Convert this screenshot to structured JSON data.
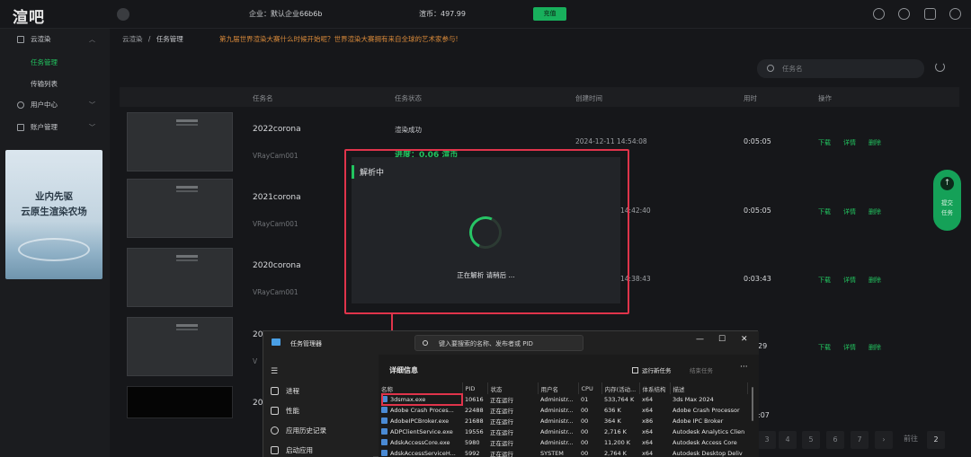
{
  "header": {
    "logo": "渲吧",
    "enterprise": "企业：默认企业66b6b",
    "balance": "渲币：497.99",
    "recharge": "充值"
  },
  "sidebar": {
    "cloud_render": "云渲染",
    "task_manage": "任务管理",
    "transfer_list": "传输列表",
    "user_center": "用户中心",
    "account_manage": "账户管理",
    "banner_line1": "业内先驱",
    "banner_line2": "云原生渲染农场"
  },
  "breadcrumb": {
    "root": "云渲染",
    "sep": "/",
    "current": "任务管理"
  },
  "notice": "第九届世界渲染大赛什么时候开始呢？世界渲染大赛拥有来自全球的艺术家参与!",
  "search": {
    "placeholder": "任务名"
  },
  "table": {
    "columns": [
      "任务名",
      "任务状态",
      "创建时间",
      "用时",
      "操作"
    ],
    "actions": [
      "下载",
      "详情",
      "删除"
    ],
    "rows": [
      {
        "name": "2022corona",
        "camera": "VRayCam001",
        "status": "渲染成功",
        "progress": "进度：0.06 渲币",
        "created": "2024-12-11 14:54:08",
        "duration": "0:05:05"
      },
      {
        "name": "2021corona",
        "camera": "VRayCam001",
        "created": "14:42:40",
        "duration": "0:05:05"
      },
      {
        "name": "2020corona",
        "camera": "VRayCam001",
        "created": "14:38:43",
        "duration": "0:03:43"
      },
      {
        "name": "20",
        "camera": "V",
        "duration": "29"
      },
      {
        "name": "20",
        "duration": ":07"
      }
    ]
  },
  "fab": {
    "line1": "提交",
    "line2": "任务"
  },
  "pager": {
    "pages": [
      "3",
      "4",
      "5",
      "6",
      "7"
    ],
    "goto": "前往",
    "current": "2"
  },
  "modal": {
    "title": "解析中",
    "message": "正在解析 请稍后 ..."
  },
  "task_manager": {
    "title": "任务管理器",
    "search_placeholder": "键入要搜索的名称、发布者或 PID",
    "nav": [
      "进程",
      "性能",
      "应用历史记录",
      "启动应用"
    ],
    "section": "详细信息",
    "run_task": "运行新任务",
    "end_task": "结束任务",
    "columns": [
      "名称",
      "PID",
      "状态",
      "用户名",
      "CPU",
      "内存(活动...",
      "体系结构",
      "描述"
    ],
    "rows": [
      [
        "3dsmax.exe",
        "10616",
        "正在运行",
        "Administr...",
        "01",
        "533,764 K",
        "x64",
        "3ds Max 2024"
      ],
      [
        "Adobe Crash Proces...",
        "22488",
        "正在运行",
        "Administr...",
        "00",
        "636 K",
        "x64",
        "Adobe Crash Processor"
      ],
      [
        "AdobeIPCBroker.exe",
        "21688",
        "正在运行",
        "Administr...",
        "00",
        "364 K",
        "x86",
        "Adobe IPC Broker"
      ],
      [
        "ADPClientService.exe",
        "19556",
        "正在运行",
        "Administr...",
        "00",
        "2,716 K",
        "x64",
        "Autodesk Analytics Clien"
      ],
      [
        "AdskAccessCore.exe",
        "5980",
        "正在运行",
        "Administr...",
        "00",
        "11,200 K",
        "x64",
        "Autodesk Access Core"
      ],
      [
        "AdskAccessServiceH...",
        "5992",
        "正在运行",
        "SYSTEM",
        "00",
        "2,764 K",
        "x64",
        "Autodesk Desktop Deliv"
      ]
    ]
  },
  "colors": {
    "accent": "#22c35f",
    "annotation": "#e0344b",
    "notice": "#d98a3a"
  }
}
